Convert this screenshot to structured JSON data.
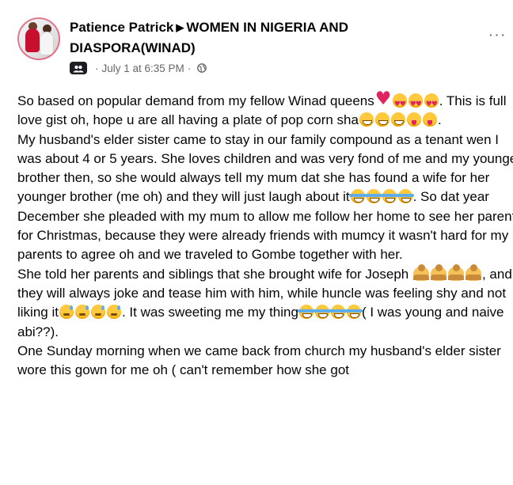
{
  "post_header": {
    "author": "Patience Patrick",
    "separator_icon": "triangle-right-icon",
    "group": "WOMEN IN NIGERIA AND DIASPORA(WINAD)",
    "timestamp": "July 1 at 6:35 PM",
    "dot": "·",
    "audience_icon": "globe-icon",
    "badge_icon": "group-badge-icon",
    "more_label": "···"
  },
  "post_body": {
    "p1_a": "So based on popular demand from my fellow Winad queens",
    "p1_b": ". This is full love gist oh, hope u are all having a plate of pop corn sha",
    "p1_c": ".",
    "p2_a": "My husband's elder sister came to stay in our family compound as a tenant wen I was about 4 or 5 years. She loves children and was very fond of me and my younger brother then, so she would always tell my mum dat she has found a wife for her younger brother (me oh) and they will just laugh about it",
    "p2_b": ". So dat year December she pleaded with my mum to allow me follow her home to see her parents for Christmas, because they were already friends with mumcy it wasn't hard for my parents to agree oh and we traveled to Gombe together with her.",
    "p3_a": "She told her parents and siblings that she brought wife for Joseph ",
    "p3_b": ", and they will always joke and tease him with him, while huncle was feeling shy and not liking it",
    "p3_c": ". It was sweeting me my thing",
    "p3_d": "( I was young and naive abi??).",
    "p4_a": "One Sunday morning when we came back from church my husband's elder sister wore this gown for me oh ( can't remember how she got"
  },
  "colors": {
    "text": "#050505",
    "secondary_text": "#65676b",
    "heart": "#e0245e",
    "emoji_yellow": "#ffc83d"
  }
}
